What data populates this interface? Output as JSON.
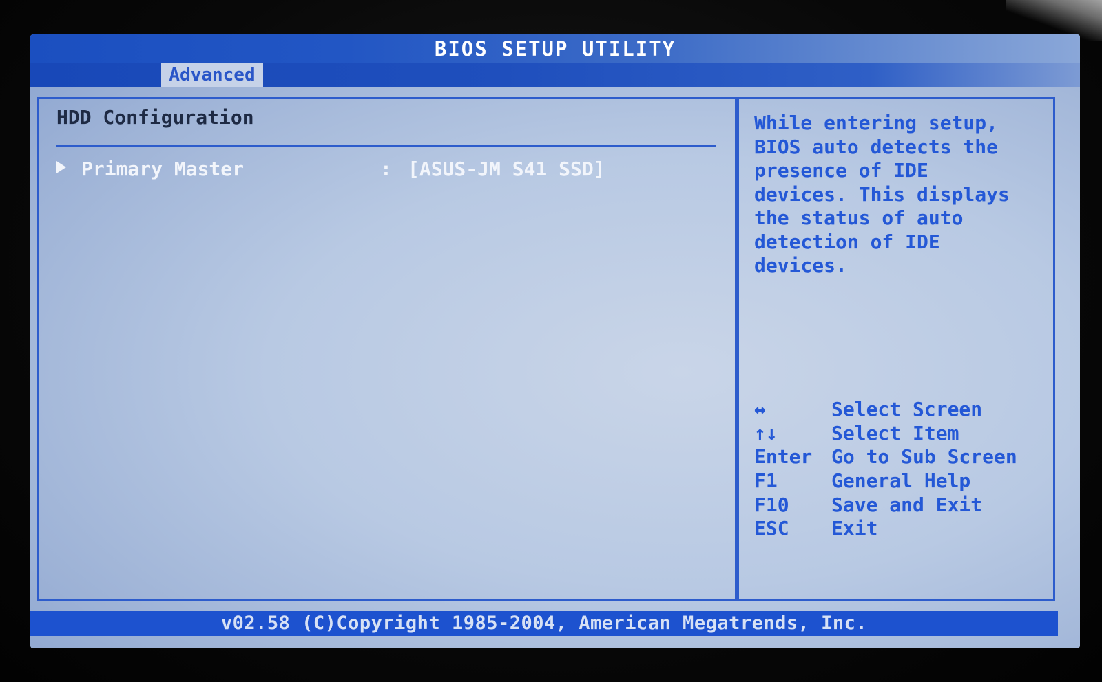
{
  "window": {
    "title": "BIOS SETUP UTILITY"
  },
  "tabs": [
    {
      "label": "Advanced",
      "active": true
    }
  ],
  "main": {
    "section_title": "HDD Configuration",
    "items": [
      {
        "label": "Primary Master",
        "separator": ":",
        "value": "[ASUS-JM S41 SSD]",
        "icon": "triangle-right-icon"
      }
    ]
  },
  "help": {
    "lines": [
      "While entering setup,",
      "BIOS auto detects the",
      "presence of IDE",
      "devices. This displays",
      "the status of auto",
      "detection of IDE",
      "devices."
    ],
    "keys": [
      {
        "key": "↔",
        "desc": "Select Screen"
      },
      {
        "key": "↑↓",
        "desc": "Select Item"
      },
      {
        "key": "Enter",
        "desc": "Go to Sub Screen"
      },
      {
        "key": "F1",
        "desc": "General Help"
      },
      {
        "key": "F10",
        "desc": "Save and Exit"
      },
      {
        "key": "ESC",
        "desc": "Exit"
      }
    ]
  },
  "footer": {
    "text": "v02.58 (C)Copyright 1985-2004, American Megatrends, Inc."
  },
  "colors": {
    "title_bar": "#1b4fc0",
    "screen_background": "#b8c9e3",
    "help_text": "#2458d6",
    "menu_text": "#f2f5fb",
    "frame_border": "#2d5ccc"
  }
}
